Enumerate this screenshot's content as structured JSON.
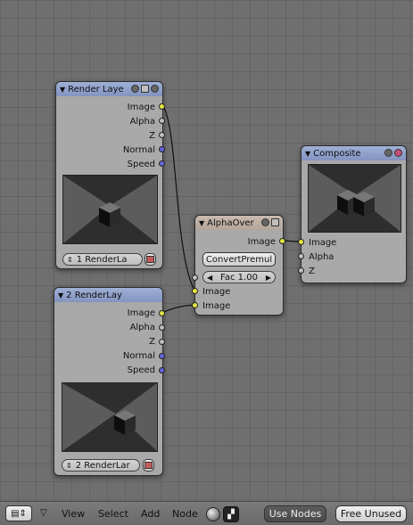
{
  "nodes": {
    "render1": {
      "title": "Render Laye",
      "outputs": [
        "Image",
        "Alpha",
        "Z",
        "Normal",
        "Speed"
      ],
      "layer_select": "1 RenderLa"
    },
    "render2": {
      "title": "2 RenderLay",
      "outputs": [
        "Image",
        "Alpha",
        "Z",
        "Normal",
        "Speed"
      ],
      "layer_select": "2 RenderLar"
    },
    "alphaover": {
      "title": "AlphaOver",
      "output": "Image",
      "convert_label": "ConvertPremul",
      "fac_label": "Fac 1.00",
      "inputs": [
        "Image",
        "Image"
      ]
    },
    "composite": {
      "title": "Composite",
      "inputs": [
        "Image",
        "Alpha",
        "Z"
      ]
    }
  },
  "toolbar": {
    "menus": [
      "View",
      "Select",
      "Add",
      "Node"
    ],
    "use_nodes": "Use Nodes",
    "free_unused": "Free Unused"
  },
  "socket_colors": {
    "image": "#e5e542",
    "value": "#bdbdbd",
    "vector": "#6565e0"
  }
}
